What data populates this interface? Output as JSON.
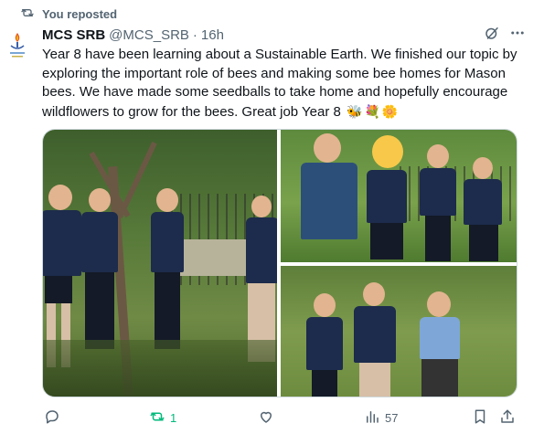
{
  "repost": {
    "label": "You reposted"
  },
  "post": {
    "author_name": "MCS SRB",
    "author_handle": "@MCS_SRB",
    "separator": "·",
    "time": "16h",
    "text": "Year 8 have been learning about a Sustainable Earth. We finished our topic by exploring the important role of bees and making some bee homes for Mason bees. We have made some seedballs to take home and hopefully encourage wildflowers to grow for the bees. Great job Year 8",
    "emojis": [
      "🐝",
      "💐",
      "🌼"
    ]
  },
  "actions": {
    "reply_count": "",
    "repost_count": "1",
    "like_count": "",
    "views_count": "57"
  },
  "icons": {
    "repost": "repost-icon",
    "grok": "grok-icon",
    "more": "more-icon",
    "reply": "reply-icon",
    "like": "heart-icon",
    "views": "views-icon",
    "bookmark": "bookmark-icon",
    "share": "share-icon"
  },
  "colors": {
    "text": "#0f1419",
    "muted": "#536471",
    "repost_active": "#00ba7c"
  }
}
